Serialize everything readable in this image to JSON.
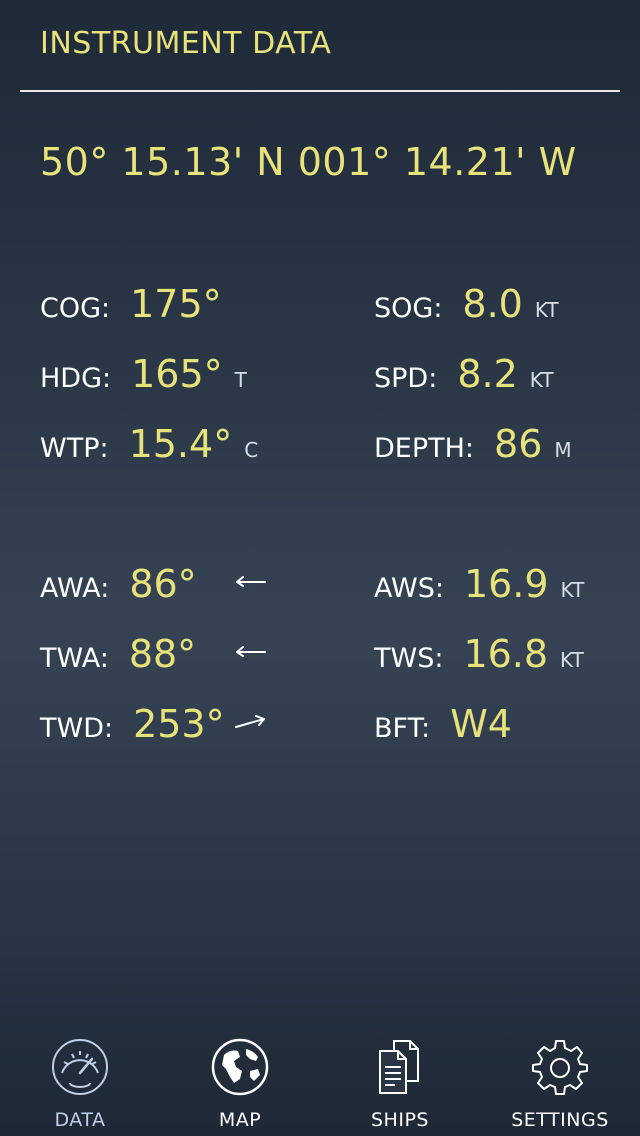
{
  "header": {
    "title": "INSTRUMENT DATA"
  },
  "position": {
    "text": "50° 15.13' N 001° 14.21' W"
  },
  "instruments": {
    "cog": {
      "label": "COG:",
      "value": "175°",
      "unit": ""
    },
    "sog": {
      "label": "SOG:",
      "value": "8.0",
      "unit": "KT"
    },
    "hdg": {
      "label": "HDG:",
      "value": "165°",
      "unit": "T"
    },
    "spd": {
      "label": "SPD:",
      "value": "8.2",
      "unit": "KT"
    },
    "wtp": {
      "label": "WTP:",
      "value": "15.4°",
      "unit": "C"
    },
    "depth": {
      "label": "DEPTH:",
      "value": "86",
      "unit": "M"
    }
  },
  "wind": {
    "awa": {
      "label": "AWA:",
      "value": "86°",
      "arrow": "left-arrow-icon"
    },
    "aws": {
      "label": "AWS:",
      "value": "16.9",
      "unit": "KT"
    },
    "twa": {
      "label": "TWA:",
      "value": "88°",
      "arrow": "left-arrow-icon"
    },
    "tws": {
      "label": "TWS:",
      "value": "16.8",
      "unit": "KT"
    },
    "twd": {
      "label": "TWD:",
      "value": "253°",
      "arrow": "up-right-arrow-icon"
    },
    "bft": {
      "label": "BFT:",
      "value": "W4"
    }
  },
  "tabs": [
    {
      "label": "DATA",
      "icon": "gauge-icon",
      "active": true
    },
    {
      "label": "MAP",
      "icon": "globe-icon",
      "active": false
    },
    {
      "label": "SHIPS",
      "icon": "documents-icon",
      "active": false
    },
    {
      "label": "SETTINGS",
      "icon": "gear-icon",
      "active": false
    }
  ],
  "colors": {
    "accent": "#e8e27a",
    "label": "#ffffff",
    "active_tab": "#bcd0ea"
  }
}
